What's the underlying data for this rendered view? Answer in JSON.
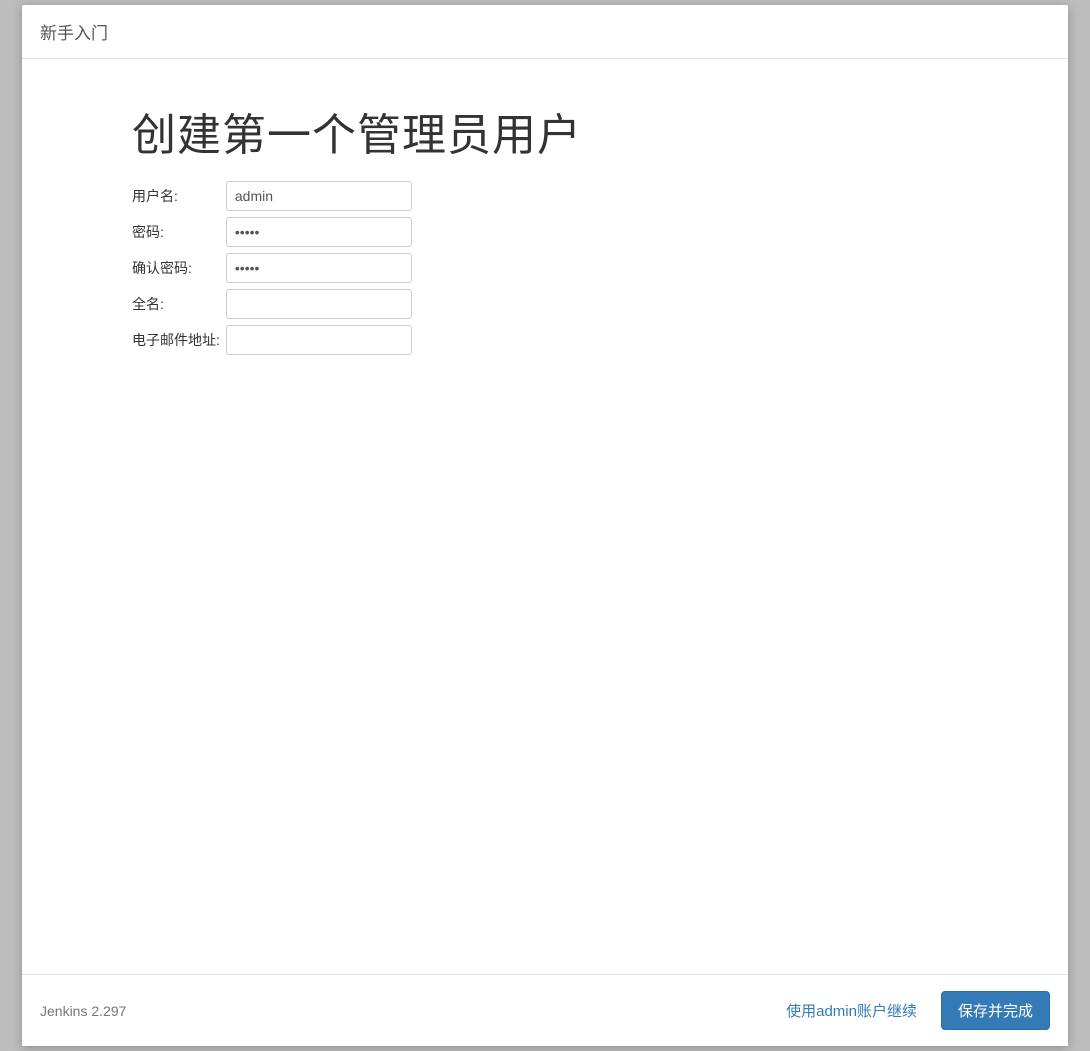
{
  "header": {
    "title": "新手入门"
  },
  "main": {
    "heading": "创建第一个管理员用户",
    "fields": {
      "username": {
        "label": "用户名:",
        "value": "admin"
      },
      "password": {
        "label": "密码:",
        "value": "•••••"
      },
      "confirm": {
        "label": "确认密码:",
        "value": "•••••"
      },
      "fullname": {
        "label": "全名:",
        "value": ""
      },
      "email": {
        "label": "电子邮件地址:",
        "value": ""
      }
    }
  },
  "footer": {
    "version": "Jenkins 2.297",
    "continue_as_admin": "使用admin账户继续",
    "save_and_finish": "保存并完成"
  }
}
